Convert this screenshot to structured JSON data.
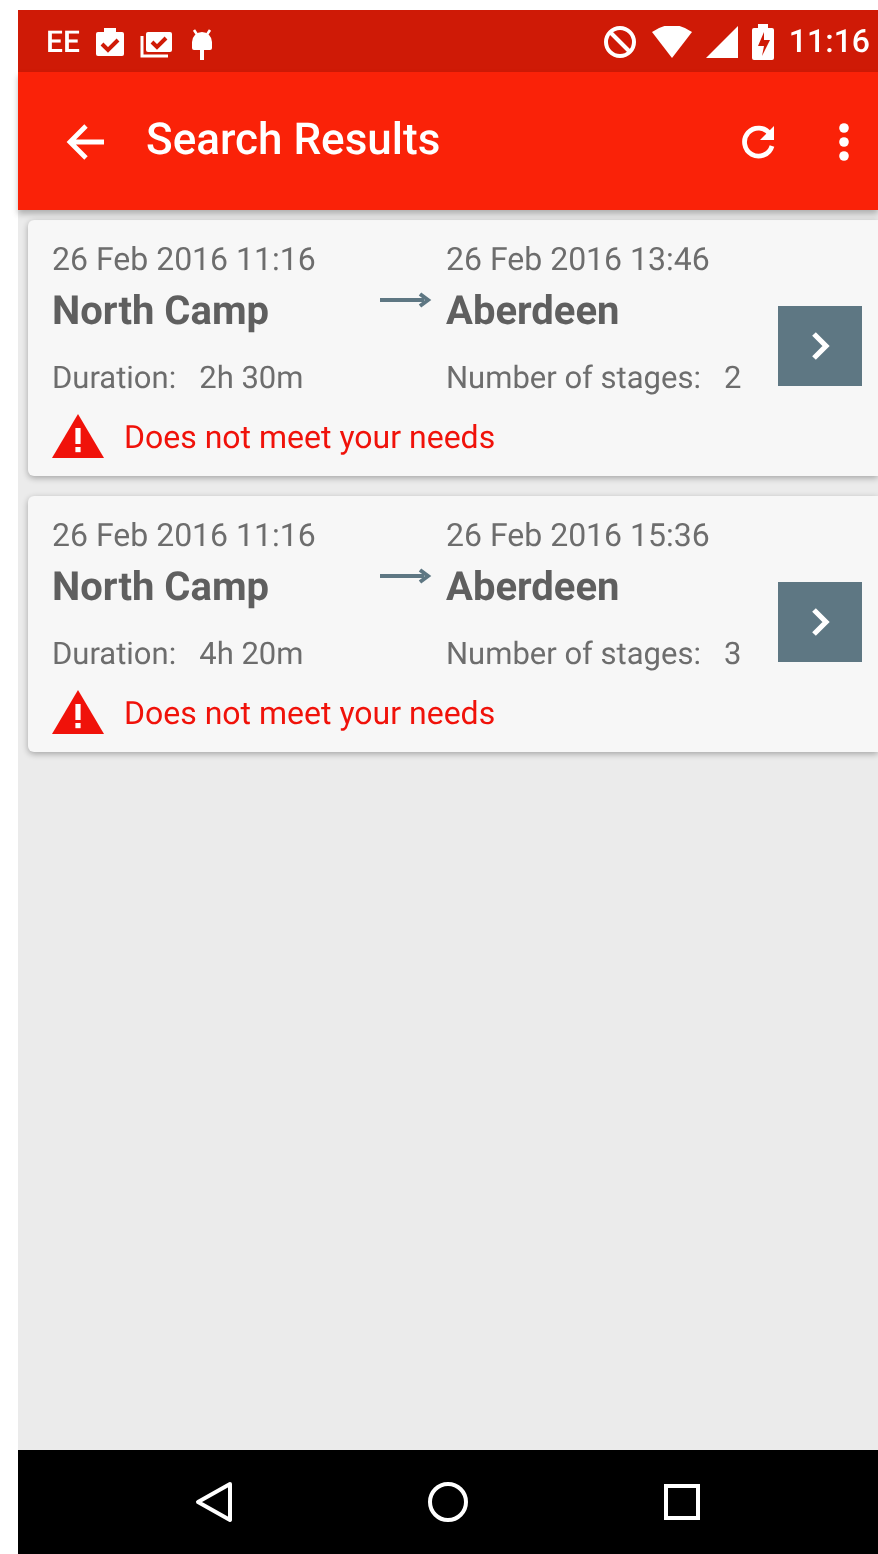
{
  "status_bar": {
    "carrier": "EE",
    "time": "11:16"
  },
  "app_bar": {
    "title": "Search Results"
  },
  "results": [
    {
      "depart_time": "26 Feb 2016 11:16",
      "origin": "North Camp",
      "arrive_time": "26 Feb 2016 13:46",
      "destination": "Aberdeen",
      "duration_label": "Duration:",
      "duration": "2h 30m",
      "stages_label": "Number of stages:",
      "stages": "2",
      "warning": "Does not meet your needs"
    },
    {
      "depart_time": "26 Feb 2016 11:16",
      "origin": "North Camp",
      "arrive_time": "26 Feb 2016 15:36",
      "destination": "Aberdeen",
      "duration_label": "Duration:",
      "duration": "4h 20m",
      "stages_label": "Number of stages:",
      "stages": "3",
      "warning": "Does not meet your needs"
    }
  ]
}
